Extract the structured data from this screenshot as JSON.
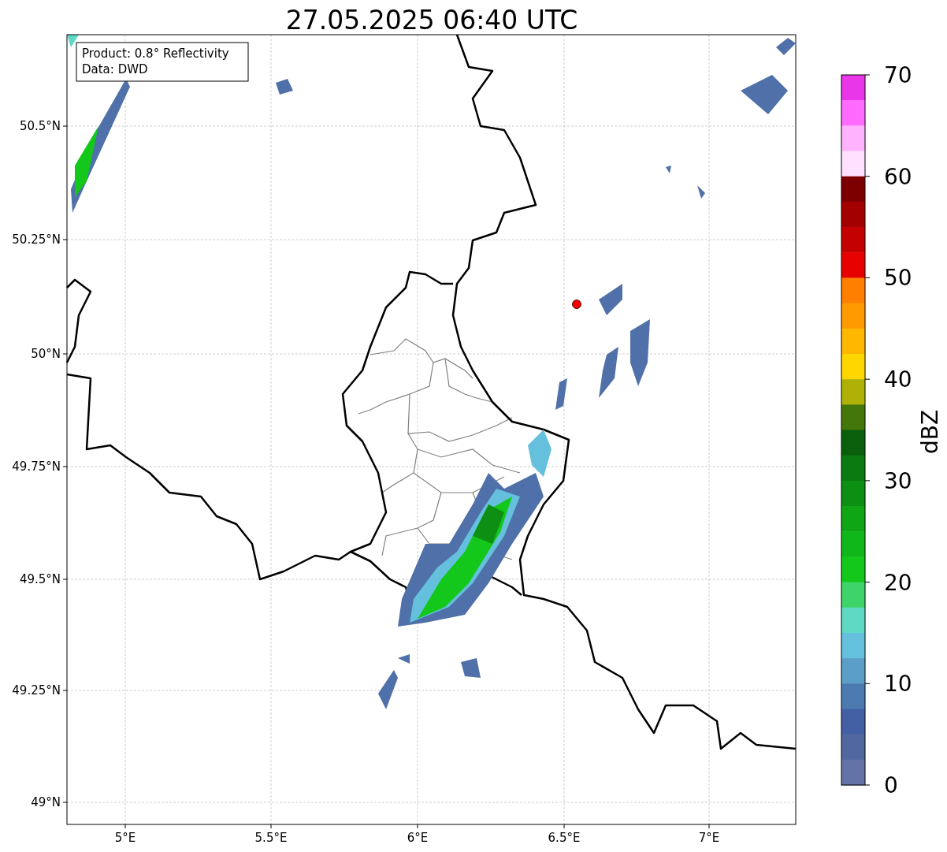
{
  "title": "27.05.2025 06:40 UTC",
  "info_box": [
    "Product: 0.8° Reflectivity",
    "Data: DWD"
  ],
  "x_ticks": [
    "5°E",
    "5.5°E",
    "6°E",
    "6.5°E",
    "7°E"
  ],
  "y_ticks": [
    "50.5°N",
    "50.25°N",
    "50°N",
    "49.75°N",
    "49.5°N",
    "49.25°N",
    "49°N"
  ],
  "colorbar": {
    "label": "dBZ",
    "ticks": [
      "70",
      "60",
      "50",
      "40",
      "30",
      "20",
      "10",
      "0"
    ],
    "segments": [
      {
        "color": "#e836e8"
      },
      {
        "color": "#ff6aff"
      },
      {
        "color": "#ffb3ff"
      },
      {
        "color": "#ffe0ff"
      },
      {
        "color": "#7d0000"
      },
      {
        "color": "#a30000"
      },
      {
        "color": "#c40000"
      },
      {
        "color": "#e60000"
      },
      {
        "color": "#ff7f00"
      },
      {
        "color": "#ff9a00"
      },
      {
        "color": "#ffb700"
      },
      {
        "color": "#ffd700"
      },
      {
        "color": "#b0b106"
      },
      {
        "color": "#44770b"
      },
      {
        "color": "#0a5f0d"
      },
      {
        "color": "#0b7a10"
      },
      {
        "color": "#0d8f13"
      },
      {
        "color": "#0fa515"
      },
      {
        "color": "#10b71a"
      },
      {
        "color": "#13c81a"
      },
      {
        "color": "#3ed46a"
      },
      {
        "color": "#5fd9c4"
      },
      {
        "color": "#64c0dc"
      },
      {
        "color": "#5b9fc8"
      },
      {
        "color": "#4a7ab0"
      },
      {
        "color": "#4460a4"
      },
      {
        "color": "#51679f"
      },
      {
        "color": "#6473a7"
      }
    ]
  }
}
